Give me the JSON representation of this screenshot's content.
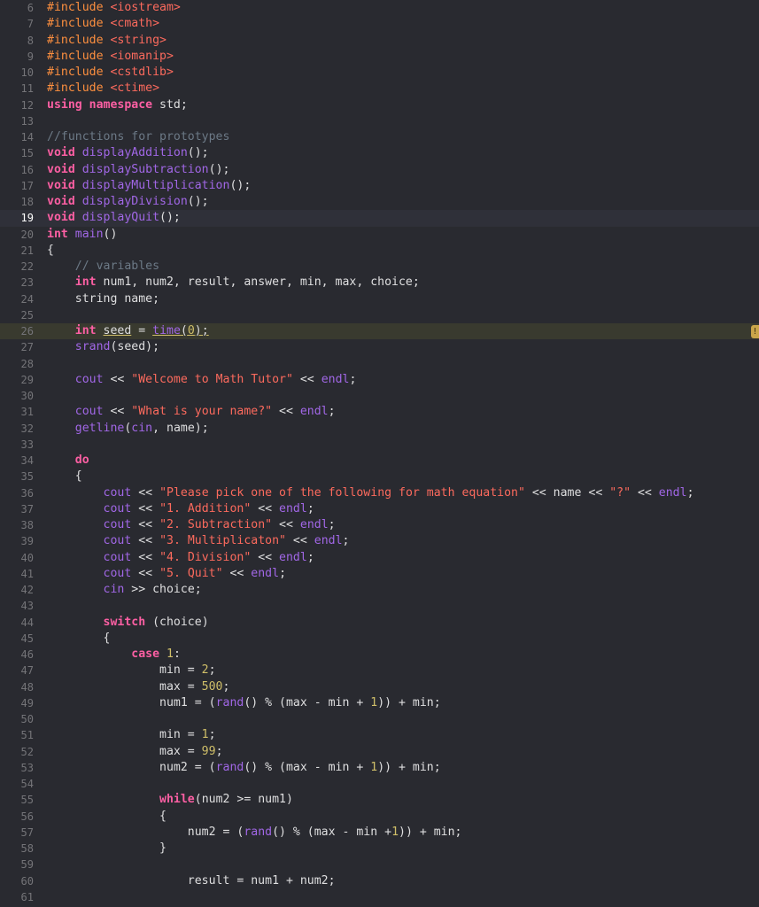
{
  "editor": {
    "lines": [
      {
        "n": "6",
        "tokens": [
          {
            "t": "#include ",
            "c": "pp"
          },
          {
            "t": "<iostream>",
            "c": "str"
          }
        ]
      },
      {
        "n": "7",
        "tokens": [
          {
            "t": "#include ",
            "c": "pp"
          },
          {
            "t": "<cmath>",
            "c": "str"
          }
        ]
      },
      {
        "n": "8",
        "tokens": [
          {
            "t": "#include ",
            "c": "pp"
          },
          {
            "t": "<string>",
            "c": "str"
          }
        ]
      },
      {
        "n": "9",
        "tokens": [
          {
            "t": "#include ",
            "c": "pp"
          },
          {
            "t": "<iomanip>",
            "c": "str"
          }
        ]
      },
      {
        "n": "10",
        "tokens": [
          {
            "t": "#include ",
            "c": "pp"
          },
          {
            "t": "<cstdlib>",
            "c": "str"
          }
        ]
      },
      {
        "n": "11",
        "tokens": [
          {
            "t": "#include ",
            "c": "pp"
          },
          {
            "t": "<ctime>",
            "c": "str"
          }
        ]
      },
      {
        "n": "12",
        "tokens": [
          {
            "t": "using namespace ",
            "c": "kw"
          },
          {
            "t": "std;",
            "c": "plain"
          }
        ]
      },
      {
        "n": "13",
        "tokens": []
      },
      {
        "n": "14",
        "tokens": [
          {
            "t": "//functions for prototypes",
            "c": "cm"
          }
        ]
      },
      {
        "n": "15",
        "tokens": [
          {
            "t": "void ",
            "c": "kw"
          },
          {
            "t": "displayAddition",
            "c": "proj"
          },
          {
            "t": "();",
            "c": "plain"
          }
        ]
      },
      {
        "n": "16",
        "tokens": [
          {
            "t": "void ",
            "c": "kw"
          },
          {
            "t": "displaySubtraction",
            "c": "proj"
          },
          {
            "t": "();",
            "c": "plain"
          }
        ]
      },
      {
        "n": "17",
        "tokens": [
          {
            "t": "void ",
            "c": "kw"
          },
          {
            "t": "displayMultiplication",
            "c": "proj"
          },
          {
            "t": "();",
            "c": "plain"
          }
        ]
      },
      {
        "n": "18",
        "tokens": [
          {
            "t": "void ",
            "c": "kw"
          },
          {
            "t": "displayDivision",
            "c": "proj"
          },
          {
            "t": "();",
            "c": "plain"
          }
        ]
      },
      {
        "n": "19",
        "tokens": [
          {
            "t": "void ",
            "c": "kw"
          },
          {
            "t": "displayQuit",
            "c": "proj"
          },
          {
            "t": "();",
            "c": "plain"
          }
        ],
        "cursor": true
      },
      {
        "n": "20",
        "tokens": [
          {
            "t": "int ",
            "c": "kw"
          },
          {
            "t": "main",
            "c": "proj"
          },
          {
            "t": "()",
            "c": "plain"
          }
        ]
      },
      {
        "n": "21",
        "tokens": [
          {
            "t": "{",
            "c": "plain"
          }
        ]
      },
      {
        "n": "22",
        "tokens": [
          {
            "t": "    // variables",
            "c": "cm"
          }
        ]
      },
      {
        "n": "23",
        "tokens": [
          {
            "t": "    ",
            "c": "plain"
          },
          {
            "t": "int ",
            "c": "kw"
          },
          {
            "t": "num1, num2, result, answer, min, max, choice;",
            "c": "plain"
          }
        ]
      },
      {
        "n": "24",
        "tokens": [
          {
            "t": "    ",
            "c": "plain"
          },
          {
            "t": "string ",
            "c": "plain"
          },
          {
            "t": "name;",
            "c": "plain"
          }
        ]
      },
      {
        "n": "25",
        "tokens": []
      },
      {
        "n": "26",
        "tokens": [
          {
            "t": "    ",
            "c": "plain"
          },
          {
            "t": "int ",
            "c": "kw"
          },
          {
            "t": "seed",
            "c": "plain uline"
          },
          {
            "t": " = ",
            "c": "plain"
          },
          {
            "t": "time",
            "c": "sys uline"
          },
          {
            "t": "(",
            "c": "plain uline"
          },
          {
            "t": "0",
            "c": "num uline"
          },
          {
            "t": ");",
            "c": "plain uline"
          }
        ],
        "warn": true
      },
      {
        "n": "27",
        "tokens": [
          {
            "t": "    ",
            "c": "plain"
          },
          {
            "t": "srand",
            "c": "sys"
          },
          {
            "t": "(seed);",
            "c": "plain"
          }
        ]
      },
      {
        "n": "28",
        "tokens": []
      },
      {
        "n": "29",
        "tokens": [
          {
            "t": "    ",
            "c": "plain"
          },
          {
            "t": "cout",
            "c": "sys"
          },
          {
            "t": " << ",
            "c": "plain"
          },
          {
            "t": "\"Welcome to Math Tutor\"",
            "c": "str"
          },
          {
            "t": " << ",
            "c": "plain"
          },
          {
            "t": "endl",
            "c": "sys"
          },
          {
            "t": ";",
            "c": "plain"
          }
        ]
      },
      {
        "n": "30",
        "tokens": []
      },
      {
        "n": "31",
        "tokens": [
          {
            "t": "    ",
            "c": "plain"
          },
          {
            "t": "cout",
            "c": "sys"
          },
          {
            "t": " << ",
            "c": "plain"
          },
          {
            "t": "\"What is your name?\"",
            "c": "str"
          },
          {
            "t": " << ",
            "c": "plain"
          },
          {
            "t": "endl",
            "c": "sys"
          },
          {
            "t": ";",
            "c": "plain"
          }
        ]
      },
      {
        "n": "32",
        "tokens": [
          {
            "t": "    ",
            "c": "plain"
          },
          {
            "t": "getline",
            "c": "sys"
          },
          {
            "t": "(",
            "c": "plain"
          },
          {
            "t": "cin",
            "c": "sys"
          },
          {
            "t": ", name);",
            "c": "plain"
          }
        ]
      },
      {
        "n": "33",
        "tokens": []
      },
      {
        "n": "34",
        "tokens": [
          {
            "t": "    ",
            "c": "plain"
          },
          {
            "t": "do",
            "c": "kw"
          }
        ]
      },
      {
        "n": "35",
        "tokens": [
          {
            "t": "    {",
            "c": "plain"
          }
        ]
      },
      {
        "n": "36",
        "tokens": [
          {
            "t": "        ",
            "c": "plain"
          },
          {
            "t": "cout",
            "c": "sys"
          },
          {
            "t": " << ",
            "c": "plain"
          },
          {
            "t": "\"Please pick one of the following for math equation\"",
            "c": "str"
          },
          {
            "t": " << name << ",
            "c": "plain"
          },
          {
            "t": "\"?\"",
            "c": "str"
          },
          {
            "t": " << ",
            "c": "plain"
          },
          {
            "t": "endl",
            "c": "sys"
          },
          {
            "t": ";",
            "c": "plain"
          }
        ]
      },
      {
        "n": "37",
        "tokens": [
          {
            "t": "        ",
            "c": "plain"
          },
          {
            "t": "cout",
            "c": "sys"
          },
          {
            "t": " << ",
            "c": "plain"
          },
          {
            "t": "\"1. Addition\"",
            "c": "str"
          },
          {
            "t": " << ",
            "c": "plain"
          },
          {
            "t": "endl",
            "c": "sys"
          },
          {
            "t": ";",
            "c": "plain"
          }
        ]
      },
      {
        "n": "38",
        "tokens": [
          {
            "t": "        ",
            "c": "plain"
          },
          {
            "t": "cout",
            "c": "sys"
          },
          {
            "t": " << ",
            "c": "plain"
          },
          {
            "t": "\"2. Subtraction\"",
            "c": "str"
          },
          {
            "t": " << ",
            "c": "plain"
          },
          {
            "t": "endl",
            "c": "sys"
          },
          {
            "t": ";",
            "c": "plain"
          }
        ]
      },
      {
        "n": "39",
        "tokens": [
          {
            "t": "        ",
            "c": "plain"
          },
          {
            "t": "cout",
            "c": "sys"
          },
          {
            "t": " << ",
            "c": "plain"
          },
          {
            "t": "\"3. Multiplicaton\"",
            "c": "str"
          },
          {
            "t": " << ",
            "c": "plain"
          },
          {
            "t": "endl",
            "c": "sys"
          },
          {
            "t": ";",
            "c": "plain"
          }
        ]
      },
      {
        "n": "40",
        "tokens": [
          {
            "t": "        ",
            "c": "plain"
          },
          {
            "t": "cout",
            "c": "sys"
          },
          {
            "t": " << ",
            "c": "plain"
          },
          {
            "t": "\"4. Division\"",
            "c": "str"
          },
          {
            "t": " << ",
            "c": "plain"
          },
          {
            "t": "endl",
            "c": "sys"
          },
          {
            "t": ";",
            "c": "plain"
          }
        ]
      },
      {
        "n": "41",
        "tokens": [
          {
            "t": "        ",
            "c": "plain"
          },
          {
            "t": "cout",
            "c": "sys"
          },
          {
            "t": " << ",
            "c": "plain"
          },
          {
            "t": "\"5. Quit\"",
            "c": "str"
          },
          {
            "t": " << ",
            "c": "plain"
          },
          {
            "t": "endl",
            "c": "sys"
          },
          {
            "t": ";",
            "c": "plain"
          }
        ]
      },
      {
        "n": "42",
        "tokens": [
          {
            "t": "        ",
            "c": "plain"
          },
          {
            "t": "cin",
            "c": "sys"
          },
          {
            "t": " >> choice;",
            "c": "plain"
          }
        ]
      },
      {
        "n": "43",
        "tokens": []
      },
      {
        "n": "44",
        "tokens": [
          {
            "t": "        ",
            "c": "plain"
          },
          {
            "t": "switch",
            "c": "kw"
          },
          {
            "t": " (choice)",
            "c": "plain"
          }
        ]
      },
      {
        "n": "45",
        "tokens": [
          {
            "t": "        {",
            "c": "plain"
          }
        ]
      },
      {
        "n": "46",
        "tokens": [
          {
            "t": "            ",
            "c": "plain"
          },
          {
            "t": "case ",
            "c": "kw"
          },
          {
            "t": "1",
            "c": "num"
          },
          {
            "t": ":",
            "c": "plain"
          }
        ]
      },
      {
        "n": "47",
        "tokens": [
          {
            "t": "                min = ",
            "c": "plain"
          },
          {
            "t": "2",
            "c": "num"
          },
          {
            "t": ";",
            "c": "plain"
          }
        ]
      },
      {
        "n": "48",
        "tokens": [
          {
            "t": "                max = ",
            "c": "plain"
          },
          {
            "t": "500",
            "c": "num"
          },
          {
            "t": ";",
            "c": "plain"
          }
        ]
      },
      {
        "n": "49",
        "tokens": [
          {
            "t": "                num1 = (",
            "c": "plain"
          },
          {
            "t": "rand",
            "c": "sys"
          },
          {
            "t": "() % (max - min + ",
            "c": "plain"
          },
          {
            "t": "1",
            "c": "num"
          },
          {
            "t": ")) + min;",
            "c": "plain"
          }
        ]
      },
      {
        "n": "50",
        "tokens": []
      },
      {
        "n": "51",
        "tokens": [
          {
            "t": "                min = ",
            "c": "plain"
          },
          {
            "t": "1",
            "c": "num"
          },
          {
            "t": ";",
            "c": "plain"
          }
        ]
      },
      {
        "n": "52",
        "tokens": [
          {
            "t": "                max = ",
            "c": "plain"
          },
          {
            "t": "99",
            "c": "num"
          },
          {
            "t": ";",
            "c": "plain"
          }
        ]
      },
      {
        "n": "53",
        "tokens": [
          {
            "t": "                num2 = (",
            "c": "plain"
          },
          {
            "t": "rand",
            "c": "sys"
          },
          {
            "t": "() % (max - min + ",
            "c": "plain"
          },
          {
            "t": "1",
            "c": "num"
          },
          {
            "t": ")) + min;",
            "c": "plain"
          }
        ]
      },
      {
        "n": "54",
        "tokens": []
      },
      {
        "n": "55",
        "tokens": [
          {
            "t": "                ",
            "c": "plain"
          },
          {
            "t": "while",
            "c": "kw"
          },
          {
            "t": "(num2 >= num1)",
            "c": "plain"
          }
        ]
      },
      {
        "n": "56",
        "tokens": [
          {
            "t": "                {",
            "c": "plain"
          }
        ]
      },
      {
        "n": "57",
        "tokens": [
          {
            "t": "                    num2 = (",
            "c": "plain"
          },
          {
            "t": "rand",
            "c": "sys"
          },
          {
            "t": "() % (max - min +",
            "c": "plain"
          },
          {
            "t": "1",
            "c": "num"
          },
          {
            "t": ")) + min;",
            "c": "plain"
          }
        ]
      },
      {
        "n": "58",
        "tokens": [
          {
            "t": "                }",
            "c": "plain"
          }
        ]
      },
      {
        "n": "59",
        "tokens": []
      },
      {
        "n": "60",
        "tokens": [
          {
            "t": "                    result = num1 + num2;",
            "c": "plain"
          }
        ]
      },
      {
        "n": "61",
        "tokens": []
      }
    ],
    "warning_glyph": "!"
  }
}
